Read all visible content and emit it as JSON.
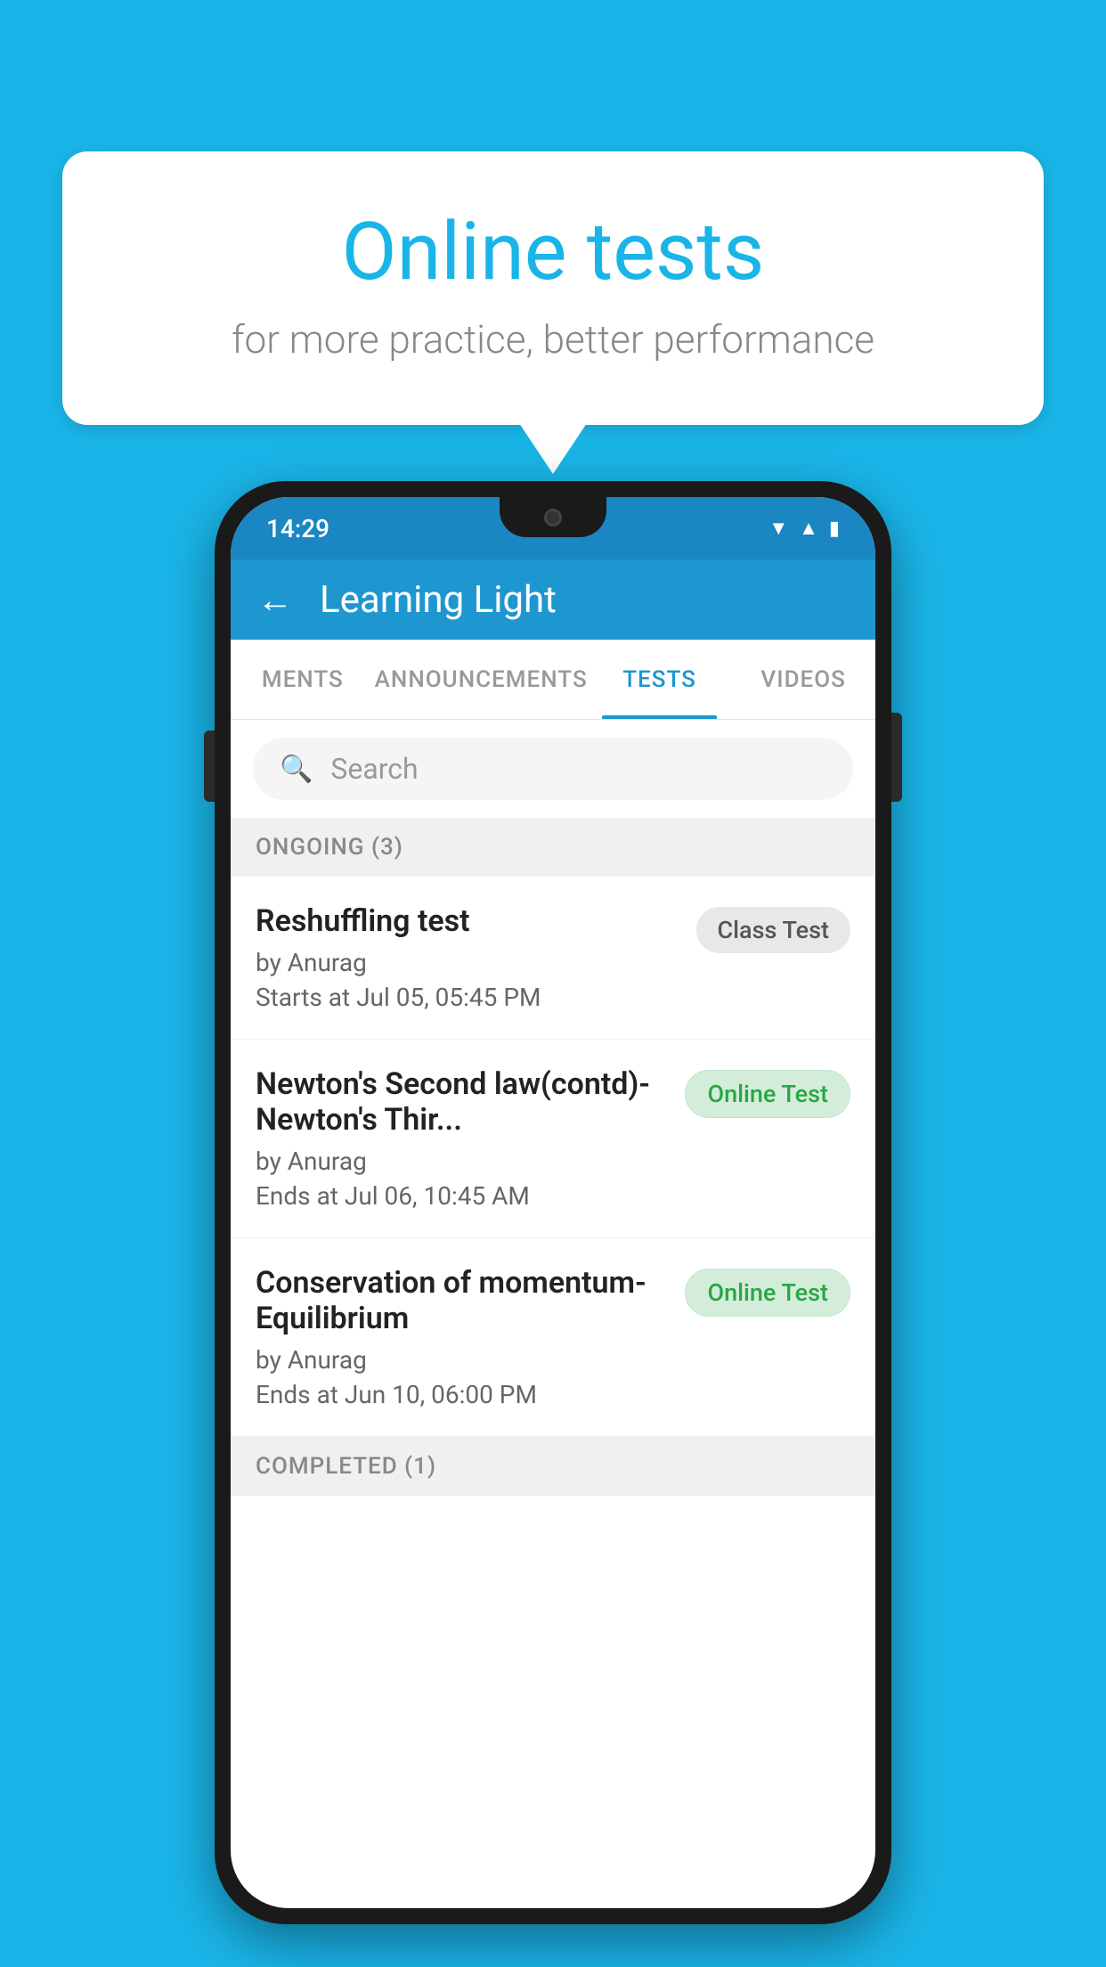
{
  "background_color": "#1ab5e8",
  "speech_bubble": {
    "title": "Online tests",
    "subtitle": "for more practice, better performance"
  },
  "phone": {
    "status_bar": {
      "time": "14:29",
      "icons": [
        "wifi",
        "signal",
        "battery"
      ]
    },
    "app_bar": {
      "title": "Learning Light",
      "back_label": "←"
    },
    "tabs": [
      {
        "label": "MENTS",
        "active": false
      },
      {
        "label": "ANNOUNCEMENTS",
        "active": false
      },
      {
        "label": "TESTS",
        "active": true
      },
      {
        "label": "VIDEOS",
        "active": false
      }
    ],
    "search": {
      "placeholder": "Search"
    },
    "ongoing_section": {
      "label": "ONGOING (3)",
      "tests": [
        {
          "name": "Reshuffling test",
          "author": "by Anurag",
          "date": "Starts at  Jul 05, 05:45 PM",
          "badge": "Class Test",
          "badge_type": "class"
        },
        {
          "name": "Newton's Second law(contd)-Newton's Thir...",
          "author": "by Anurag",
          "date": "Ends at  Jul 06, 10:45 AM",
          "badge": "Online Test",
          "badge_type": "online"
        },
        {
          "name": "Conservation of momentum-Equilibrium",
          "author": "by Anurag",
          "date": "Ends at  Jun 10, 06:00 PM",
          "badge": "Online Test",
          "badge_type": "online"
        }
      ]
    },
    "completed_section": {
      "label": "COMPLETED (1)"
    }
  }
}
